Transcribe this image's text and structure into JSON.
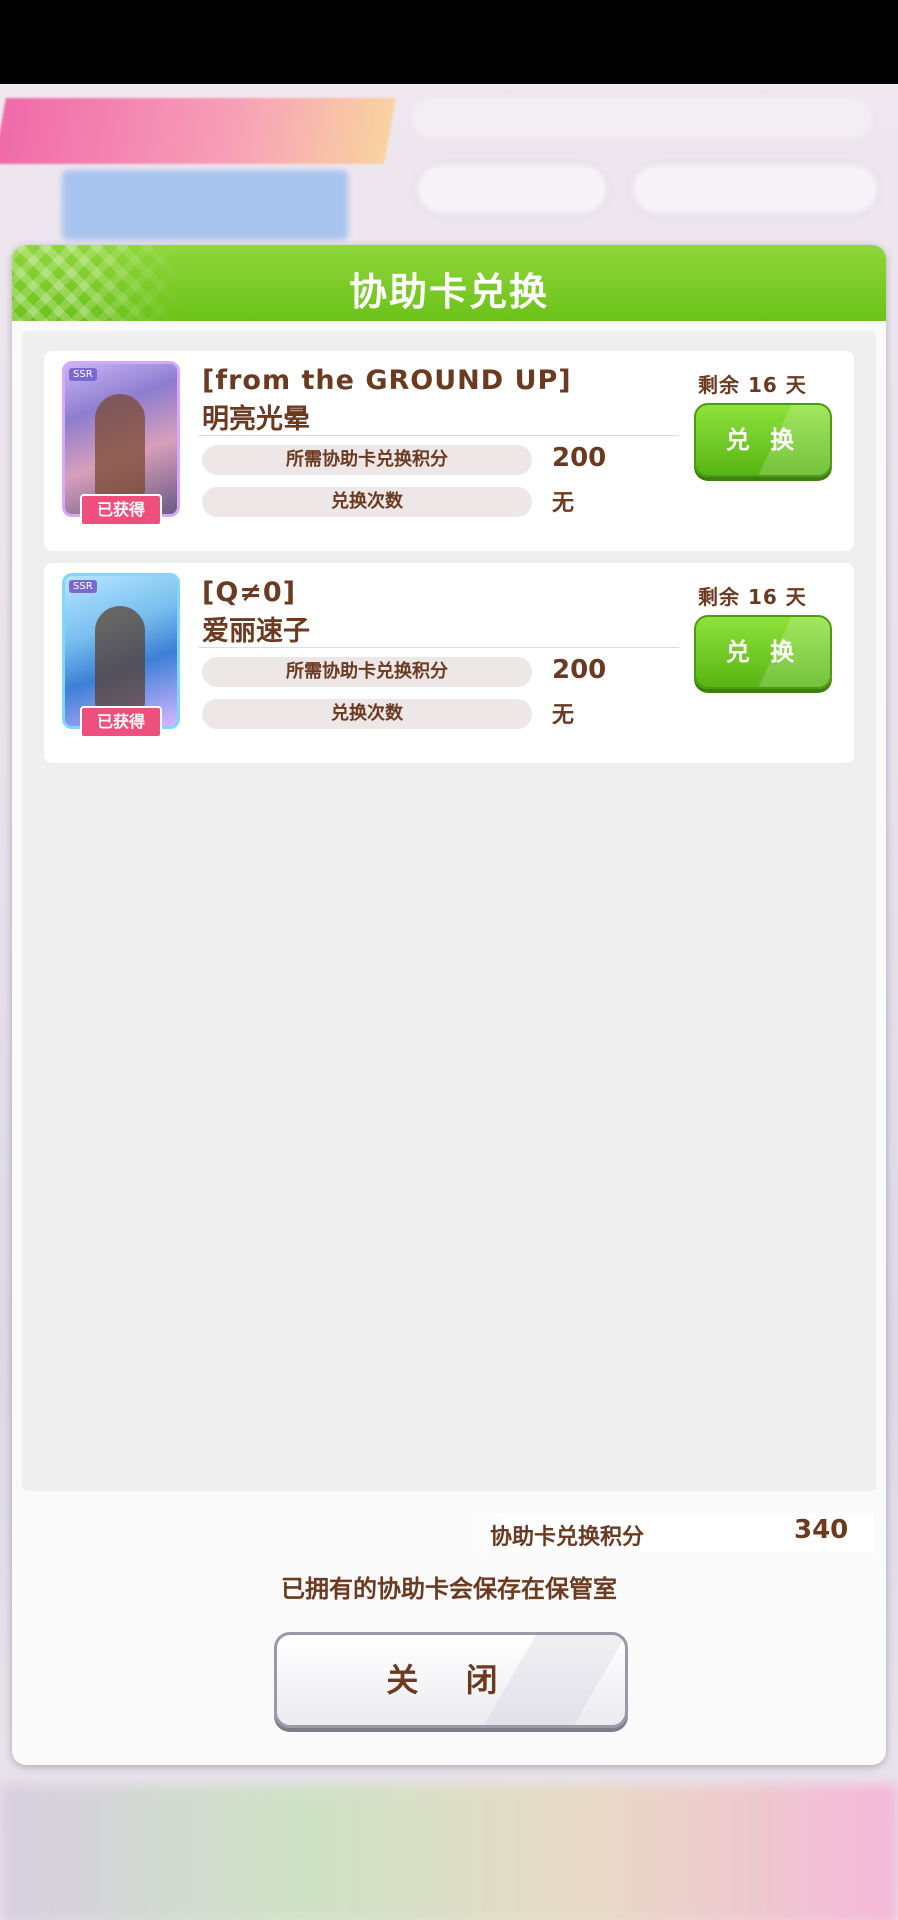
{
  "dialog": {
    "title": "协助卡兑换",
    "items": [
      {
        "title_line1": "[from the GROUND UP]",
        "title_line2": "明亮光晕",
        "cost_label": "所需协助卡兑换积分",
        "cost_value": "200",
        "count_label": "兑换次数",
        "count_value": "无",
        "remaining": "剩余 16 天",
        "exchange_label": "兑 换",
        "owned_label": "已获得",
        "rarity": "SSR"
      },
      {
        "title_line1": "[Q≠0]",
        "title_line2": "爱丽速子",
        "cost_label": "所需协助卡兑换积分",
        "cost_value": "200",
        "count_label": "兑换次数",
        "count_value": "无",
        "remaining": "剩余 16 天",
        "exchange_label": "兑 换",
        "owned_label": "已获得",
        "rarity": "SSR"
      }
    ],
    "points_label": "协助卡兑换积分",
    "points_value": "340",
    "note": "已拥有的协助卡会保存在保管室",
    "close_label": "关 闭"
  },
  "colors": {
    "header_green": "#6cc21a",
    "text_brown": "#6b3a20",
    "owned_pink": "#ef4f7c"
  }
}
